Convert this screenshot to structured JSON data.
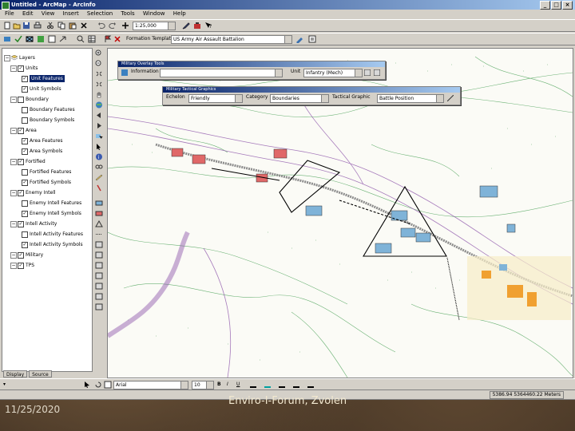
{
  "window": {
    "title": "Untitled - ArcMap - ArcInfo",
    "controls": [
      "_",
      "□",
      "×"
    ]
  },
  "menu": {
    "items": [
      "File",
      "Edit",
      "View",
      "Insert",
      "Selection",
      "Tools",
      "Window",
      "Help"
    ]
  },
  "toolbar": {
    "scale": "1:25,000",
    "formation_label": "Formation Template:",
    "formation_value": "US Army Air Assault Battalion"
  },
  "toc": {
    "root": "Layers",
    "items": [
      {
        "label": "Units",
        "checked": true,
        "level": 1
      },
      {
        "label": "Unit Features",
        "checked": true,
        "level": 2,
        "selected": true
      },
      {
        "label": "Unit Symbols",
        "checked": true,
        "level": 2
      },
      {
        "label": "Boundary",
        "checked": false,
        "level": 1
      },
      {
        "label": "Boundary Features",
        "checked": false,
        "level": 2
      },
      {
        "label": "Boundary Symbols",
        "checked": false,
        "level": 2
      },
      {
        "label": "Area",
        "checked": true,
        "level": 1
      },
      {
        "label": "Area Features",
        "checked": true,
        "level": 2
      },
      {
        "label": "Area Symbols",
        "checked": true,
        "level": 2
      },
      {
        "label": "Fortified",
        "checked": true,
        "level": 1
      },
      {
        "label": "Fortified Features",
        "checked": false,
        "level": 2
      },
      {
        "label": "Fortified Symbols",
        "checked": true,
        "level": 2
      },
      {
        "label": "Enemy Intell",
        "checked": true,
        "level": 1
      },
      {
        "label": "Enemy Intell Features",
        "checked": false,
        "level": 2
      },
      {
        "label": "Enemy Intell Symbols",
        "checked": true,
        "level": 2
      },
      {
        "label": "Intell Activity",
        "checked": true,
        "level": 1
      },
      {
        "label": "Intell Activity Features",
        "checked": false,
        "level": 2
      },
      {
        "label": "Intell Activity Symbols",
        "checked": true,
        "level": 2
      },
      {
        "label": "Military",
        "checked": true,
        "level": 1
      },
      {
        "label": "TPS",
        "checked": true,
        "level": 1
      }
    ],
    "tabs": [
      "Display",
      "Source"
    ]
  },
  "palette_overlay": {
    "title": "Military Overlay Tools",
    "label": "Information",
    "value": "",
    "unit_label": "Unit",
    "unit_value": "Infantry (Mech)"
  },
  "palette_tactical": {
    "title": "Military Tactical Graphics",
    "echelon_label": "Echelon",
    "echelon_value": "Friendly",
    "category_label": "Category",
    "category_value": "Boundaries",
    "graphic_label": "Tactical Graphic",
    "graphic_value": "Battle Position"
  },
  "drawing": {
    "font": "Arial",
    "size": "10",
    "bold": "B",
    "italic": "I",
    "underline": "U"
  },
  "status": {
    "coords": "5386.94  5364460.22 Meters"
  },
  "slide": {
    "date": "11/25/2020",
    "footer": "Enviro-I-Forum, Zvolen"
  },
  "colors": {
    "map_green": "#3c9a4a",
    "map_purple": "#8a50a8",
    "map_gray": "#8c8c8c",
    "unit_red": "#e06868",
    "unit_blue": "#7fb3d8",
    "urban_orange": "#f0a030"
  }
}
